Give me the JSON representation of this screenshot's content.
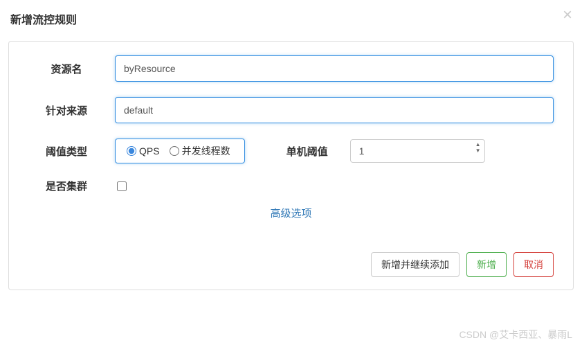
{
  "modal": {
    "title": "新增流控规则"
  },
  "form": {
    "resourceLabel": "资源名",
    "resourceValue": "byResource",
    "sourceLabel": "针对来源",
    "sourceValue": "default",
    "thresholdTypeLabel": "阈值类型",
    "radioOptions": {
      "qps": "QPS",
      "threads": "并发线程数"
    },
    "singleThresholdLabel": "单机阈值",
    "singleThresholdValue": "1",
    "clusterLabel": "是否集群",
    "advancedLink": "高级选项"
  },
  "buttons": {
    "addContinue": "新增并继续添加",
    "add": "新增",
    "cancel": "取消"
  },
  "watermark": "CSDN @艾卡西亚、暴雨L"
}
